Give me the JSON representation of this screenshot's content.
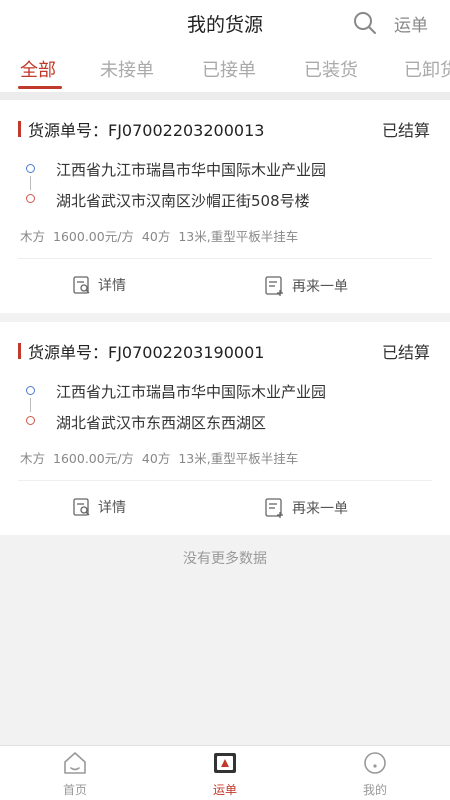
{
  "header": {
    "title": "我的货源",
    "right_link": "运单"
  },
  "tabs": [
    {
      "label": "全部"
    },
    {
      "label": "未接单"
    },
    {
      "label": "已接单"
    },
    {
      "label": "已装货"
    },
    {
      "label": "已卸货"
    }
  ],
  "colors": {
    "accent": "#c0392b",
    "start_dot": "#4a7bd0",
    "end_dot": "#d0584a"
  },
  "orders": [
    {
      "order_label": "货源单号：FJ07002203200013",
      "status": "已结算",
      "from": "江西省九江市瑞昌市华中国际木业产业园",
      "to": "湖北省武汉市汉南区沙帽正街508号楼",
      "cargo": "木方",
      "price": "1600.00元/方",
      "volume": "40方",
      "vehicle": "13米,重型平板半挂车",
      "detail_label": "详情",
      "reorder_label": "再来一单"
    },
    {
      "order_label": "货源单号：FJ07002203190001",
      "status": "已结算",
      "from": "江西省九江市瑞昌市华中国际木业产业园",
      "to": "湖北省武汉市东西湖区东西湖区",
      "cargo": "木方",
      "price": "1600.00元/方",
      "volume": "40方",
      "vehicle": "13米,重型平板半挂车",
      "detail_label": "详情",
      "reorder_label": "再来一单"
    }
  ],
  "no_more": "没有更多数据",
  "bottom_nav": [
    {
      "label": "首页",
      "icon": "home-icon"
    },
    {
      "label": "运单",
      "icon": "waybill-icon"
    },
    {
      "label": "我的",
      "icon": "profile-icon"
    }
  ]
}
